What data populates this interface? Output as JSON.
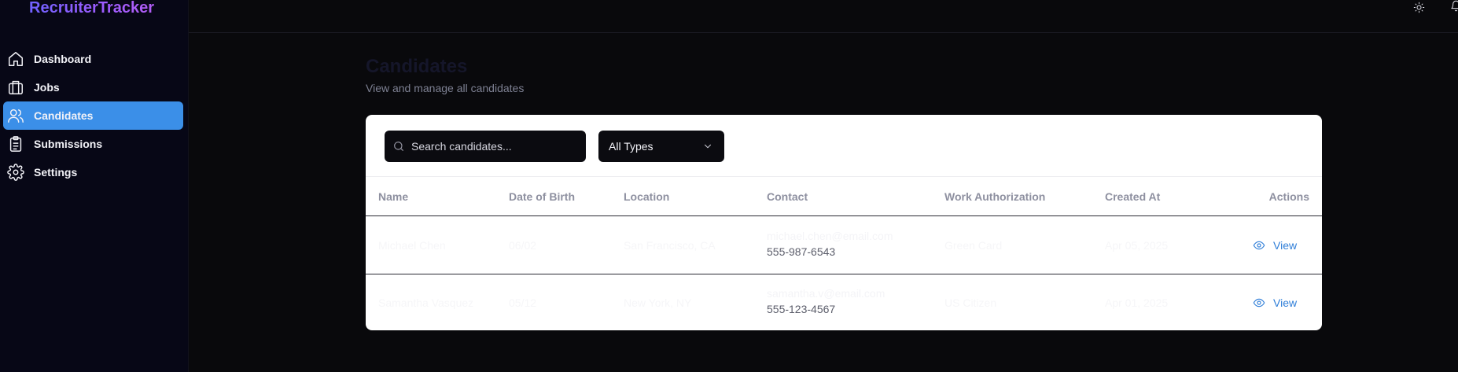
{
  "app": {
    "brand": "RecruiterTracker"
  },
  "sidebar": {
    "items": [
      {
        "label": "Dashboard",
        "icon": "home-icon",
        "active": false
      },
      {
        "label": "Jobs",
        "icon": "briefcase-icon",
        "active": false
      },
      {
        "label": "Candidates",
        "icon": "users-icon",
        "active": true
      },
      {
        "label": "Submissions",
        "icon": "clipboard-icon",
        "active": false
      },
      {
        "label": "Settings",
        "icon": "gear-icon",
        "active": false
      }
    ]
  },
  "header": {
    "theme_icon": "sun-icon",
    "notifications_icon": "bell-icon"
  },
  "page": {
    "title": "Candidates",
    "subtitle": "View and manage all candidates"
  },
  "filters": {
    "search_placeholder": "Search candidates...",
    "type_selected": "All Types"
  },
  "table": {
    "columns": [
      "Name",
      "Date of Birth",
      "Location",
      "Contact",
      "Work Authorization",
      "Created At",
      "Actions"
    ],
    "rows": [
      {
        "name": "Michael Chen",
        "dob": "06/02",
        "location": "San Francisco, CA",
        "email": "michael.chen@email.com",
        "phone": "555-987-6543",
        "work_authorization": "Green Card",
        "created_at": "Apr 05, 2025",
        "action": "View"
      },
      {
        "name": "Samantha Vasquez",
        "dob": "05/12",
        "location": "New York, NY",
        "email": "samantha.v@email.com",
        "phone": "555-123-4567",
        "work_authorization": "US Citizen",
        "created_at": "Apr 01, 2025",
        "action": "View"
      }
    ]
  },
  "colors": {
    "accent": "#3b8fe8",
    "link": "#2f7ed8",
    "background": "#09090c",
    "card": "#ffffff"
  }
}
